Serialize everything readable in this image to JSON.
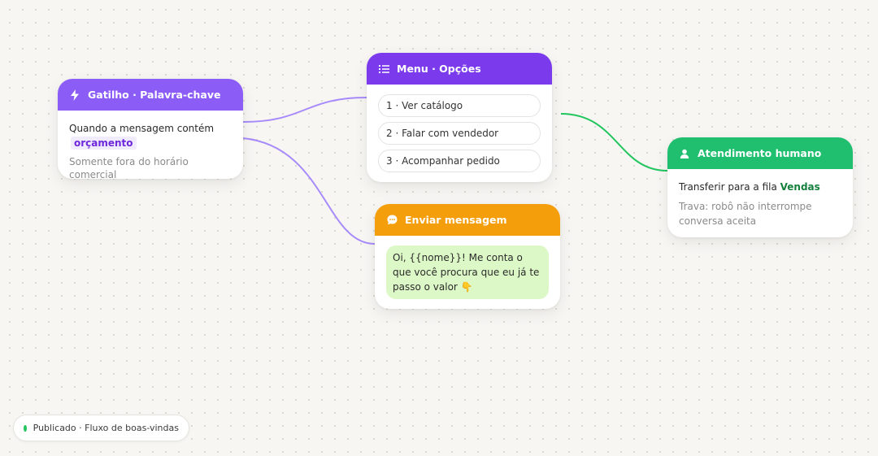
{
  "colors": {
    "trigger": "#8b5cf6",
    "menu": "#7c3aed",
    "message": "#f59e0b",
    "human": "#1fbf6f",
    "wire_purple": "#a78bfa",
    "wire_green": "#22c55e"
  },
  "trigger": {
    "icon": "lightning-icon",
    "title": "Gatilho · Palavra-chave",
    "condition": "Quando a mensagem contém",
    "keyword": "orçamento",
    "note": "Somente fora do horário comercial"
  },
  "menu": {
    "icon": "numbered-list-icon",
    "title": "Menu · Opções",
    "options": [
      "1 · Ver catálogo",
      "2 · Falar com vendedor",
      "3 · Acompanhar pedido"
    ]
  },
  "message": {
    "icon": "chat-bubble-icon",
    "title": "Enviar mensagem",
    "text": "Oi, {{nome}}! Me conta o que você procura que eu já te passo o valor 👇"
  },
  "human": {
    "icon": "person-icon",
    "title": "Atendimento humano",
    "transfer_label": "Transferir para a fila",
    "queue": "Vendas",
    "lock_note": "Trava: robô não interrompe conversa aceita"
  },
  "status": {
    "text": "Publicado · Fluxo de boas-vindas"
  }
}
